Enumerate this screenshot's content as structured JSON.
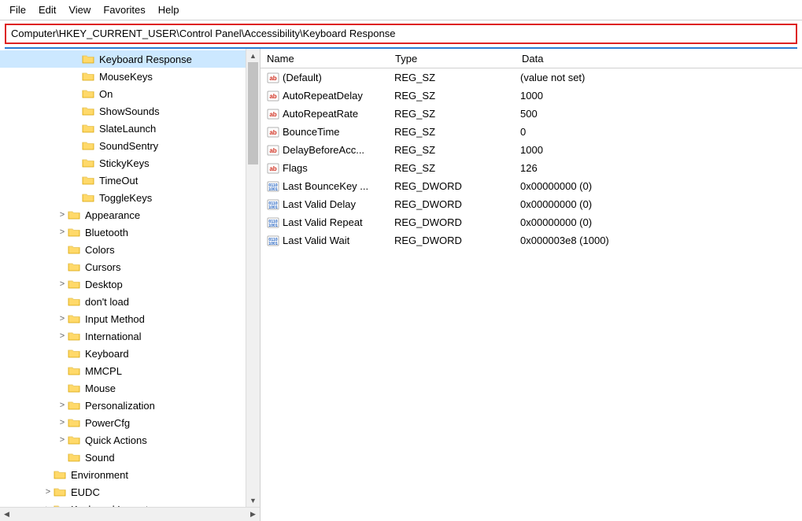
{
  "menu": {
    "items": [
      "File",
      "Edit",
      "View",
      "Favorites",
      "Help"
    ]
  },
  "address": "Computer\\HKEY_CURRENT_USER\\Control Panel\\Accessibility\\Keyboard Response",
  "tree": [
    {
      "indent": 5,
      "exp": "",
      "label": "Keyboard Response",
      "sel": true
    },
    {
      "indent": 5,
      "exp": "",
      "label": "MouseKeys"
    },
    {
      "indent": 5,
      "exp": "",
      "label": "On"
    },
    {
      "indent": 5,
      "exp": "",
      "label": "ShowSounds"
    },
    {
      "indent": 5,
      "exp": "",
      "label": "SlateLaunch"
    },
    {
      "indent": 5,
      "exp": "",
      "label": "SoundSentry"
    },
    {
      "indent": 5,
      "exp": "",
      "label": "StickyKeys"
    },
    {
      "indent": 5,
      "exp": "",
      "label": "TimeOut"
    },
    {
      "indent": 5,
      "exp": "",
      "label": "ToggleKeys"
    },
    {
      "indent": 4,
      "exp": ">",
      "label": "Appearance"
    },
    {
      "indent": 4,
      "exp": ">",
      "label": "Bluetooth"
    },
    {
      "indent": 4,
      "exp": "",
      "label": "Colors"
    },
    {
      "indent": 4,
      "exp": "",
      "label": "Cursors"
    },
    {
      "indent": 4,
      "exp": ">",
      "label": "Desktop"
    },
    {
      "indent": 4,
      "exp": "",
      "label": "don't load"
    },
    {
      "indent": 4,
      "exp": ">",
      "label": "Input Method"
    },
    {
      "indent": 4,
      "exp": ">",
      "label": "International"
    },
    {
      "indent": 4,
      "exp": "",
      "label": "Keyboard"
    },
    {
      "indent": 4,
      "exp": "",
      "label": "MMCPL"
    },
    {
      "indent": 4,
      "exp": "",
      "label": "Mouse"
    },
    {
      "indent": 4,
      "exp": ">",
      "label": "Personalization"
    },
    {
      "indent": 4,
      "exp": ">",
      "label": "PowerCfg"
    },
    {
      "indent": 4,
      "exp": ">",
      "label": "Quick Actions"
    },
    {
      "indent": 4,
      "exp": "",
      "label": "Sound"
    },
    {
      "indent": 3,
      "exp": "",
      "label": "Environment"
    },
    {
      "indent": 3,
      "exp": ">",
      "label": "EUDC"
    },
    {
      "indent": 3,
      "exp": ">",
      "label": "Keyboard Layout"
    }
  ],
  "columns": {
    "name": "Name",
    "type": "Type",
    "data": "Data"
  },
  "values": [
    {
      "icon": "sz",
      "name": "(Default)",
      "type": "REG_SZ",
      "data": "(value not set)"
    },
    {
      "icon": "sz",
      "name": "AutoRepeatDelay",
      "type": "REG_SZ",
      "data": "1000"
    },
    {
      "icon": "sz",
      "name": "AutoRepeatRate",
      "type": "REG_SZ",
      "data": "500"
    },
    {
      "icon": "sz",
      "name": "BounceTime",
      "type": "REG_SZ",
      "data": "0"
    },
    {
      "icon": "sz",
      "name": "DelayBeforeAcc...",
      "type": "REG_SZ",
      "data": "1000"
    },
    {
      "icon": "sz",
      "name": "Flags",
      "type": "REG_SZ",
      "data": "126"
    },
    {
      "icon": "dw",
      "name": "Last BounceKey ...",
      "type": "REG_DWORD",
      "data": "0x00000000 (0)"
    },
    {
      "icon": "dw",
      "name": "Last Valid Delay",
      "type": "REG_DWORD",
      "data": "0x00000000 (0)"
    },
    {
      "icon": "dw",
      "name": "Last Valid Repeat",
      "type": "REG_DWORD",
      "data": "0x00000000 (0)"
    },
    {
      "icon": "dw",
      "name": "Last Valid Wait",
      "type": "REG_DWORD",
      "data": "0x000003e8 (1000)"
    }
  ]
}
